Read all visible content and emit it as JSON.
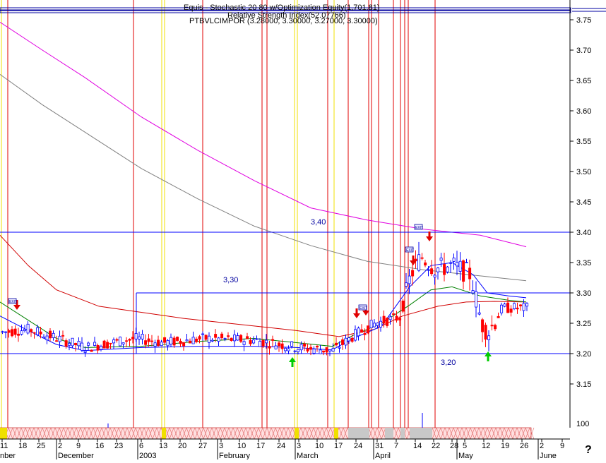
{
  "header": {
    "line1": "Equis - Stochastic 20 80 w/Optimization Equity(1,701.81)",
    "line2": "Relative Strength Index(52.07766)",
    "line3": "PTBVLCIMPOR (3.28000, 3.30000, 3.27000, 3.30000)"
  },
  "help_glyph": "?",
  "footer_glyph": "100",
  "colors": {
    "up": "#0000ff",
    "down": "#ff0000",
    "ma_short": "#008000",
    "ma_mid": "#d00000",
    "ma_long_gray": "#808080",
    "ma_long_magenta": "#e000e0",
    "level_line": "#0000ff",
    "vline_red": "#e00000",
    "vline_yellow": "#f0e000",
    "buy_arrow": "#00cc00",
    "sell_arrow": "#e00000"
  },
  "chart_data": {
    "type": "candlestick",
    "ylim": [
      3.1,
      3.8
    ],
    "y_ticks": [
      "3.75",
      "3.70",
      "3.65",
      "3.60",
      "3.55",
      "3.50",
      "3.45",
      "3.40",
      "3.35",
      "3.30",
      "3.25",
      "3.20",
      "3.15"
    ],
    "x_day_labels": [
      "11",
      "18",
      "25",
      "2",
      "9",
      "16",
      "23",
      "6",
      "13",
      "20",
      "27",
      "3",
      "10",
      "17",
      "24",
      "3",
      "10",
      "17",
      "24",
      "31",
      "7",
      "14",
      "22",
      "28",
      "5",
      "12",
      "19",
      "26",
      "2",
      "9"
    ],
    "x_month_labels": [
      "nber",
      "December",
      "2003",
      "February",
      "March",
      "April",
      "May",
      "June"
    ],
    "level_labels": [
      "3,40",
      "3,30",
      "3,20"
    ],
    "levels": [
      3.4,
      3.3,
      3.2
    ],
    "exit_label": "EXIT",
    "series": [
      {
        "name": "PTBVLCIMPOR",
        "kind": "ohlc"
      }
    ]
  }
}
